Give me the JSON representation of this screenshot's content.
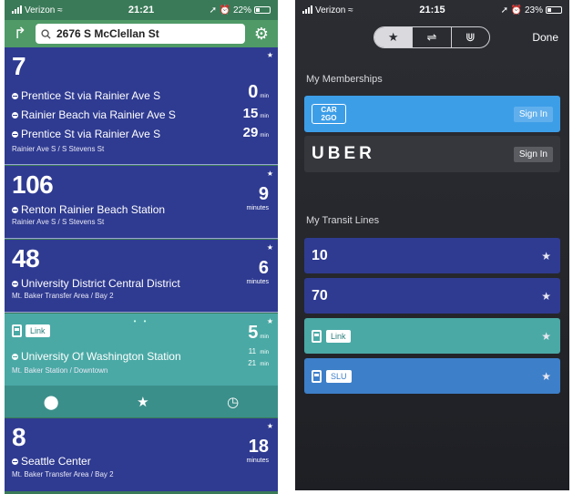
{
  "left": {
    "status": {
      "carrier": "Verizon",
      "time": "21:21",
      "battery": "22%"
    },
    "search_value": "2676 S McClellan St",
    "cards": [
      {
        "route": "7",
        "rows": [
          {
            "dest": "Prentice St via Rainier Ave S",
            "eta": "0",
            "unit": "min"
          },
          {
            "dest": "Rainier Beach via Rainier Ave S",
            "eta": "15",
            "unit": "min"
          },
          {
            "dest": "Prentice St via Rainier Ave S",
            "eta": "29",
            "unit": "min"
          }
        ],
        "stop": "Rainier Ave S / S Stevens St"
      },
      {
        "route": "106",
        "dest": "Renton Rainier Beach Station",
        "eta": "9",
        "unit": "minutes",
        "stop": "Rainier Ave S / S Stevens St"
      },
      {
        "route": "48",
        "dest": "University District Central District",
        "eta": "6",
        "unit": "minutes",
        "stop": "Mt. Baker Transfer Area / Bay 2"
      },
      {
        "route": "Link",
        "dest": "University Of Washington Station",
        "eta": "5",
        "unit": "min",
        "eta2": "11",
        "eta3": "21",
        "unit2": "min",
        "stop": "Mt. Baker Station / Downtown"
      },
      {
        "route": "8",
        "dest": "Seattle Center",
        "eta": "18",
        "unit": "minutes",
        "stop": "Mt. Baker Transfer Area / Bay 2"
      }
    ]
  },
  "right": {
    "status": {
      "carrier": "Verizon",
      "time": "21:15",
      "battery": "23%"
    },
    "done_label": "Done",
    "memberships_title": "My Memberships",
    "car2go_logo": [
      "CAR",
      "2GO"
    ],
    "uber_logo": "UBER",
    "signin_label": "Sign In",
    "transit_title": "My Transit Lines",
    "lines": [
      "10",
      "70",
      "Link",
      "SLU"
    ]
  }
}
